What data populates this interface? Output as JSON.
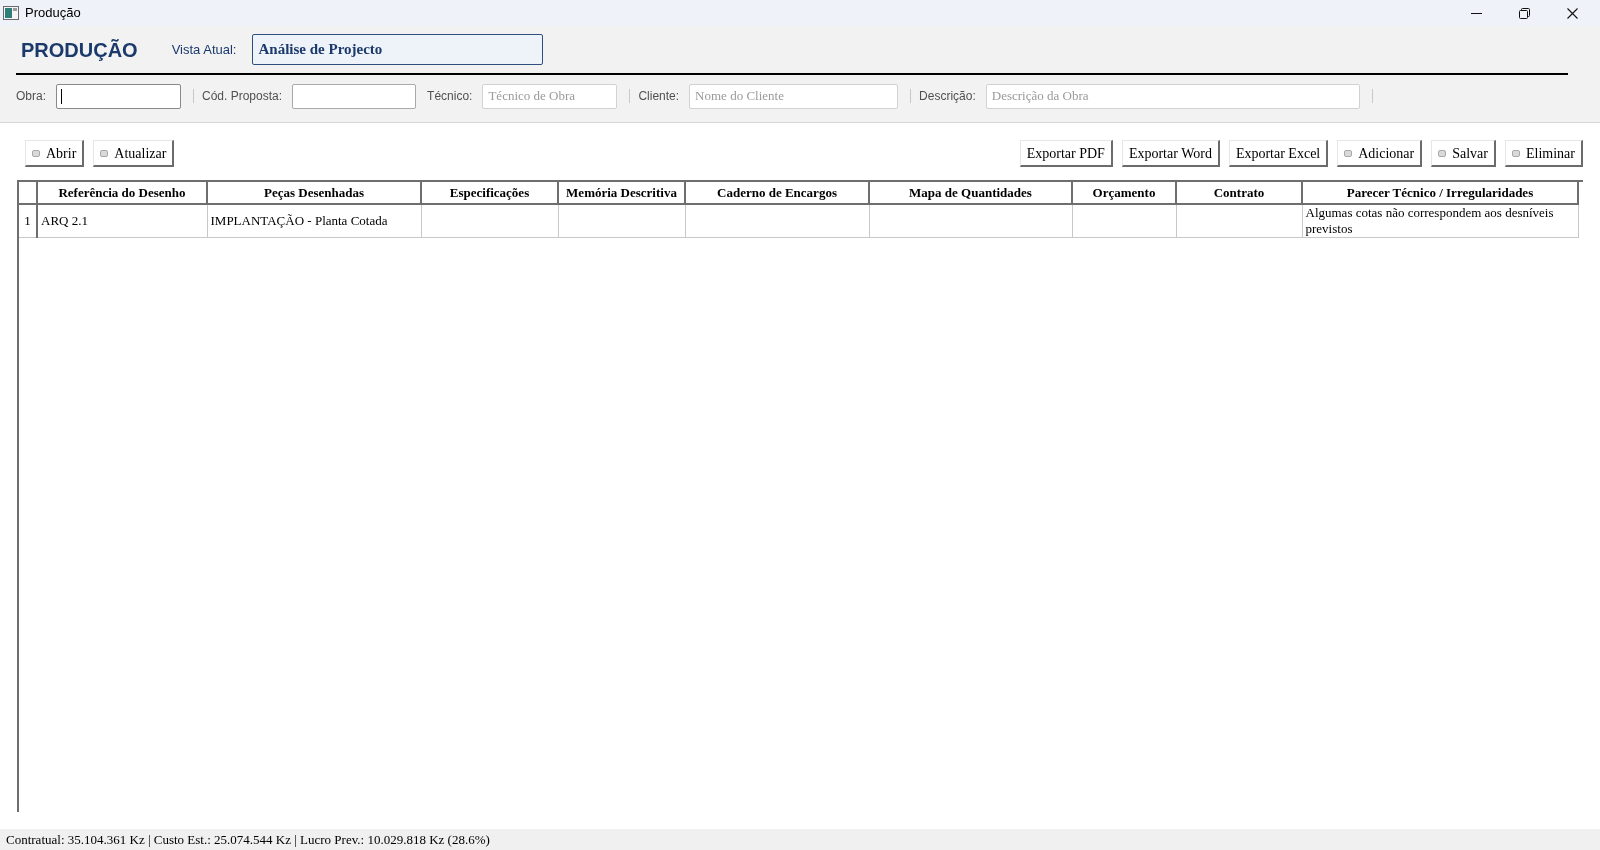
{
  "window": {
    "title": "Produção"
  },
  "header": {
    "title": "PRODUÇÃO",
    "view_label": "Vista Atual:",
    "view_value": "Análise de Projecto"
  },
  "filters": [
    {
      "label": "Obra:",
      "focused": true,
      "separator_after": true
    },
    {
      "label": "Cód. Proposta:",
      "focused": false,
      "separator_after": false
    },
    {
      "label": "Técnico:",
      "placeholder": "Técnico de Obra",
      "focused": false,
      "separator_after": true
    },
    {
      "label": "Cliente:",
      "placeholder": "Nome do Cliente",
      "focused": false,
      "separator_after": true
    },
    {
      "label": "Descrição:",
      "placeholder": "Descrição da Obra",
      "focused": false,
      "separator_after": true
    }
  ],
  "toolbar": {
    "left": [
      {
        "label": "Abrir",
        "has_icon": true
      },
      {
        "label": "Atualizar",
        "has_icon": true
      }
    ],
    "right": [
      {
        "label": "Exportar PDF",
        "has_icon": false
      },
      {
        "label": "Exportar Word",
        "has_icon": false
      },
      {
        "label": "Exportar Excel",
        "has_icon": false
      },
      {
        "label": "Adicionar",
        "has_icon": true
      },
      {
        "label": "Salvar",
        "has_icon": true
      },
      {
        "label": "Eliminar",
        "has_icon": true
      }
    ]
  },
  "table": {
    "columns": [
      "Referência do Desenho",
      "Peças Desenhadas",
      "Especificações",
      "Memória Descritiva",
      "Caderno de Encargos",
      "Mapa de Quantidades",
      "Orçamento",
      "Contrato",
      "Parecer Técnico / Irregularidades"
    ],
    "rows": [
      {
        "number": "1",
        "cells": [
          {
            "text": "ARQ 2.1"
          },
          {
            "text": "IMPLANTAÇÃO - Planta Cotada"
          },
          {},
          {},
          {},
          {},
          {},
          {},
          {
            "text": "Algumas cotas não correspondem aos desníveis previstos"
          }
        ]
      }
    ]
  },
  "status_bar": {
    "text": "Contratual: 35.104.361 Kz | Custo Est.: 25.074.544 Kz | Lucro Prev.: 10.029.818 Kz (28.6%)"
  }
}
